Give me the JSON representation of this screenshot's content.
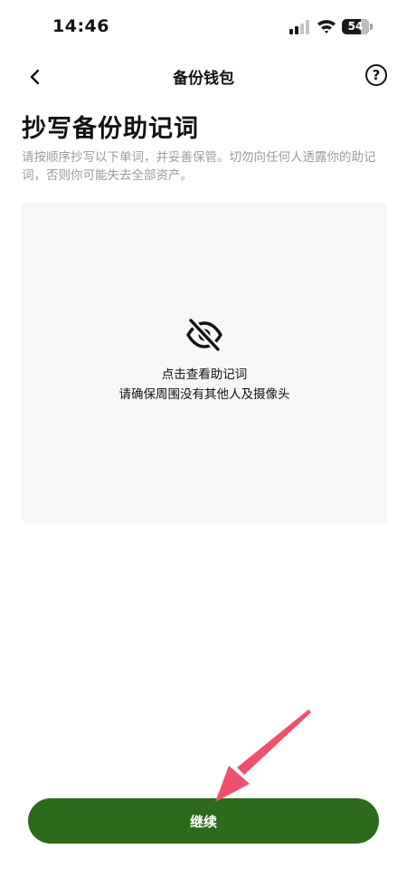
{
  "status_bar": {
    "time": "14:46",
    "battery_level": "54",
    "icons": [
      "cellular-signal-icon",
      "wifi-icon",
      "battery-icon"
    ]
  },
  "nav": {
    "title": "备份钱包",
    "back_icon": "chevron-left-icon",
    "help_label": "?"
  },
  "main": {
    "heading": "抄写备份助记词",
    "description": "请按顺序抄写以下单词，并妥善保管。切勿向任何人透露你的助记词，否则你可能失去全部资产。",
    "reveal_panel": {
      "icon": "eye-off-icon",
      "title": "点击查看助记词",
      "note": "请确保周围没有其他人及摄像头"
    }
  },
  "footer": {
    "continue_label": "继续"
  },
  "colors": {
    "primary_button": "#2c6b1a",
    "panel_background": "#f7f7f7",
    "description_text": "#9a9a9a",
    "annotation_arrow": "#f0506e"
  }
}
